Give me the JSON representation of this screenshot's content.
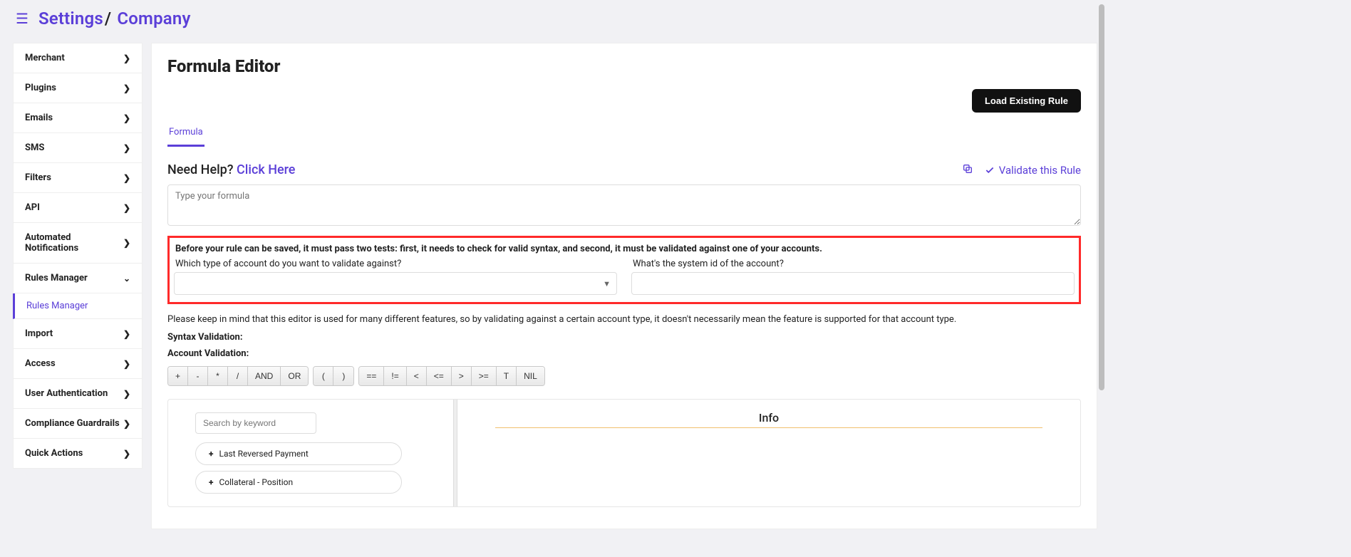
{
  "breadcrumbs": {
    "a": "Settings",
    "b": "Company"
  },
  "sidebar": [
    {
      "label": "Merchant",
      "type": "item"
    },
    {
      "label": "Plugins",
      "type": "item"
    },
    {
      "label": "Emails",
      "type": "item"
    },
    {
      "label": "SMS",
      "type": "item"
    },
    {
      "label": "Filters",
      "type": "item"
    },
    {
      "label": "API",
      "type": "item"
    },
    {
      "label": "Automated Notifications",
      "type": "item"
    },
    {
      "label": "Rules Manager",
      "type": "item-open"
    },
    {
      "label": "Rules Manager",
      "type": "sub"
    },
    {
      "label": "Import",
      "type": "item"
    },
    {
      "label": "Access",
      "type": "item"
    },
    {
      "label": "User Authentication",
      "type": "item"
    },
    {
      "label": "Compliance Guardrails",
      "type": "item"
    },
    {
      "label": "Quick Actions",
      "type": "item"
    }
  ],
  "page_title": "Formula Editor",
  "load_button": "Load Existing Rule",
  "tabs": {
    "formula": "Formula"
  },
  "help": {
    "need": "Need Help? ",
    "click": "Click Here",
    "validate": "Validate this Rule"
  },
  "formula_placeholder": "Type your formula",
  "redbox": {
    "note": "Before your rule can be saved, it must pass two tests: first, it needs to check for valid syntax, and second, it must be validated against one of your accounts.",
    "q1": "Which type of account do you want to validate against?",
    "q2": "What's the system id of the account?"
  },
  "keep_in_mind": "Please keep in mind that this editor is used for many different features, so by validating against a certain account type, it doesn't necessarily mean the feature is supported for that account type.",
  "syntax_label": "Syntax Validation:",
  "account_label": "Account Validation:",
  "ops": {
    "g1": [
      "+",
      "-",
      "*",
      "/",
      "AND",
      "OR"
    ],
    "g2": [
      "(",
      ")"
    ],
    "g3": [
      "==",
      "!=",
      "<",
      "<=",
      ">",
      ">=",
      "T",
      "NIL"
    ]
  },
  "search_placeholder": "Search by keyword",
  "pills": [
    "Last Reversed Payment",
    "Collateral - Position"
  ],
  "info_title": "Info"
}
